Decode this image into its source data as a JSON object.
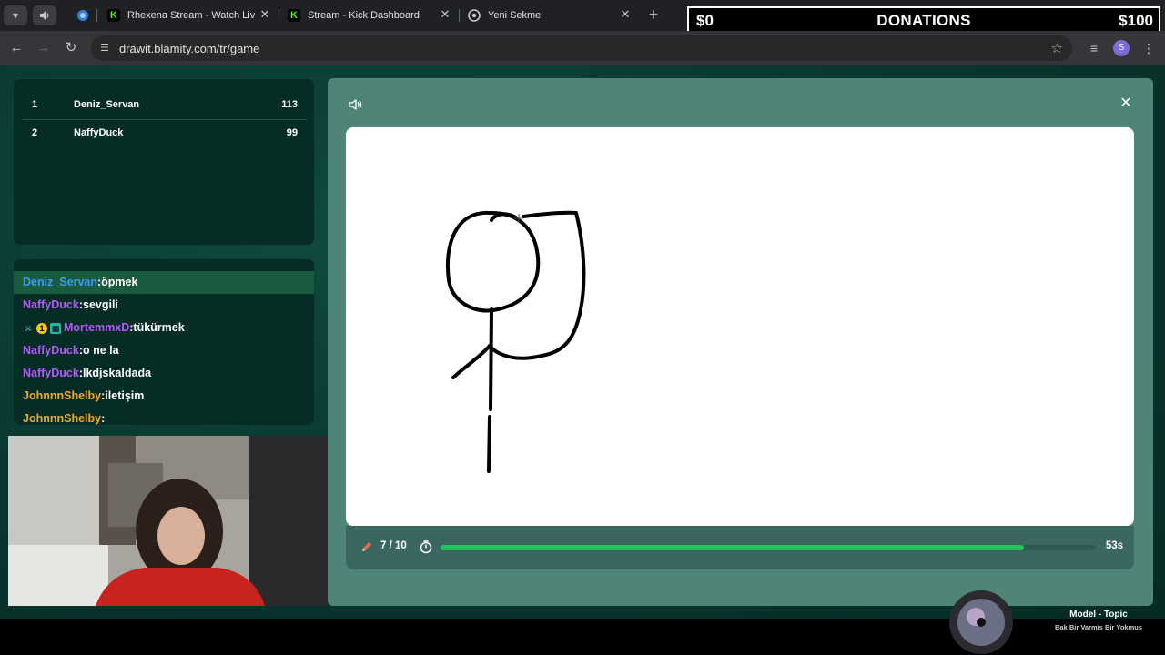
{
  "browser": {
    "tabs": [
      {
        "title": "Rhexena Stream - Watch Live o",
        "favicon": "kick-icon"
      },
      {
        "title": "Stream - Kick Dashboard",
        "favicon": "kick-icon"
      },
      {
        "title": "Yeni Sekme",
        "favicon": "chrome-icon"
      }
    ],
    "url": "drawit.blamity.com/tr/game",
    "profile_initial": "S"
  },
  "donations": {
    "current": "$0",
    "label": "DONATIONS",
    "goal": "$100"
  },
  "scoreboard": {
    "rows": [
      {
        "rank": "1",
        "name": "Deniz_Servan",
        "score": "113"
      },
      {
        "rank": "2",
        "name": "NaffyDuck",
        "score": "99"
      }
    ]
  },
  "chat": {
    "messages": [
      {
        "user": "Deniz_Servan",
        "text": "öpmek",
        "color": "#3b9cf2"
      },
      {
        "user": "NaffyDuck",
        "text": "sevgili",
        "color": "#b25cf5"
      },
      {
        "user": "MortemmxD",
        "text": "tükürmek",
        "color": "#b25cf5"
      },
      {
        "user": "NaffyDuck",
        "text": "o ne la",
        "color": "#b25cf5"
      },
      {
        "user": "NaffyDuck",
        "text": "lkdjskaldada",
        "color": "#b25cf5"
      },
      {
        "user": "JohnnnShelby",
        "text": "iletişim",
        "color": "#f0a92b"
      },
      {
        "user": "JohnnnShelby",
        "text": "",
        "color": "#f0a92b"
      }
    ]
  },
  "game": {
    "round": "7 / 10",
    "time_left": "53s",
    "progress": 0.89,
    "accent": "#22c55e"
  },
  "music": {
    "title": "Model - Topic",
    "subtitle": "Bak Bir Varmis Bir Yokmus"
  }
}
